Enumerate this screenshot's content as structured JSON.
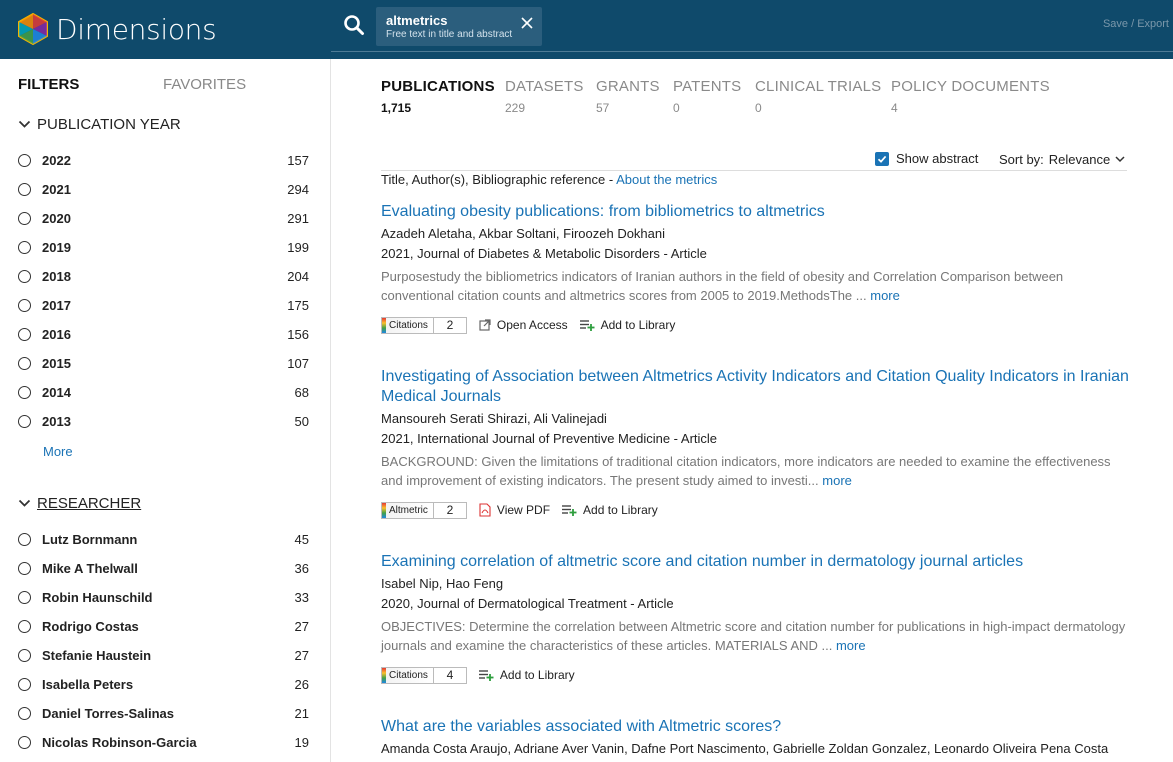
{
  "app": {
    "logo_text": "Dimensions",
    "save_export": "Save / Export",
    "colors": {
      "header": "#0f4a6b",
      "link": "#1a73b5"
    }
  },
  "search": {
    "icon": "search-icon",
    "term": "altmetrics",
    "scope": "Free text in title and abstract"
  },
  "sidebar": {
    "filters_tab": "FILTERS",
    "favorites_tab": "FAVORITES",
    "publication_year": {
      "heading": "PUBLICATION YEAR",
      "items": [
        {
          "label": "2022",
          "count": "157"
        },
        {
          "label": "2021",
          "count": "294"
        },
        {
          "label": "2020",
          "count": "291"
        },
        {
          "label": "2019",
          "count": "199"
        },
        {
          "label": "2018",
          "count": "204"
        },
        {
          "label": "2017",
          "count": "175"
        },
        {
          "label": "2016",
          "count": "156"
        },
        {
          "label": "2015",
          "count": "107"
        },
        {
          "label": "2014",
          "count": "68"
        },
        {
          "label": "2013",
          "count": "50"
        }
      ],
      "more": "More"
    },
    "researcher": {
      "heading": "RESEARCHER",
      "items": [
        {
          "label": "Lutz Bornmann",
          "count": "45"
        },
        {
          "label": "Mike A Thelwall",
          "count": "36"
        },
        {
          "label": "Robin Haunschild",
          "count": "33"
        },
        {
          "label": "Rodrigo Costas",
          "count": "27"
        },
        {
          "label": "Stefanie Haustein",
          "count": "27"
        },
        {
          "label": "Isabella Peters",
          "count": "26"
        },
        {
          "label": "Daniel Torres-Salinas",
          "count": "21"
        },
        {
          "label": "Nicolas Robinson-Garcia",
          "count": "19"
        }
      ]
    }
  },
  "tabs": [
    {
      "label": "PUBLICATIONS",
      "count": "1,715",
      "active": true
    },
    {
      "label": "DATASETS",
      "count": "229"
    },
    {
      "label": "GRANTS",
      "count": "57"
    },
    {
      "label": "PATENTS",
      "count": "0"
    },
    {
      "label": "CLINICAL TRIALS",
      "count": "0"
    },
    {
      "label": "POLICY DOCUMENTS",
      "count": "4"
    }
  ],
  "results": {
    "show_abstract_label": "Show abstract",
    "show_abstract_checked": true,
    "sort_label": "Sort by:",
    "sort_value": "Relevance",
    "column_header": "Title, Author(s), Bibliographic reference - ",
    "about_metrics": "About the metrics",
    "more_label": "more",
    "items": [
      {
        "title": "Evaluating obesity publications: from bibliometrics to altmetrics",
        "authors": "Azadeh Aletaha, Akbar Soltani, Firoozeh Dokhani",
        "reference": "2021, Journal of Diabetes & Metabolic Disorders - Article",
        "abstract": "Purposestudy the bibliometrics indicators of Iranian authors in the field of obesity and Correlation Comparison between conventional citation counts and altmetrics scores from 2005 to 2019.MethodsThe ...",
        "badge": "Citations",
        "badge_count": "2",
        "actions": [
          "Open Access",
          "Add to Library"
        ]
      },
      {
        "title": "Investigating of Association between Altmetrics Activity Indicators and Citation Quality Indicators in Iranian Medical Journals",
        "authors": "Mansoureh Serati Shirazi, Ali Valinejadi",
        "reference": "2021, International Journal of Preventive Medicine - Article",
        "abstract": "BACKGROUND: Given the limitations of traditional citation indicators, more indicators are needed to examine the effectiveness and improvement of existing indicators. The present study aimed to investi...",
        "badge": "Altmetric",
        "badge_count": "2",
        "actions": [
          "View PDF",
          "Add to Library"
        ]
      },
      {
        "title": "Examining correlation of altmetric score and citation number in dermatology journal articles",
        "authors": "Isabel Nip, Hao Feng",
        "reference": "2020, Journal of Dermatological Treatment - Article",
        "abstract": "OBJECTIVES: Determine the correlation between Altmetric score and citation number for publications in high-impact dermatology journals and examine the characteristics of these articles. MATERIALS AND ...",
        "badge": "Citations",
        "badge_count": "4",
        "actions": [
          "Add to Library"
        ]
      },
      {
        "title": "What are the variables associated with Altmetric scores?",
        "authors": "Amanda Costa Araujo, Adriane Aver Vanin, Dafne Port Nascimento, Gabrielle Zoldan Gonzalez, Leonardo Oliveira Pena Costa"
      }
    ]
  }
}
